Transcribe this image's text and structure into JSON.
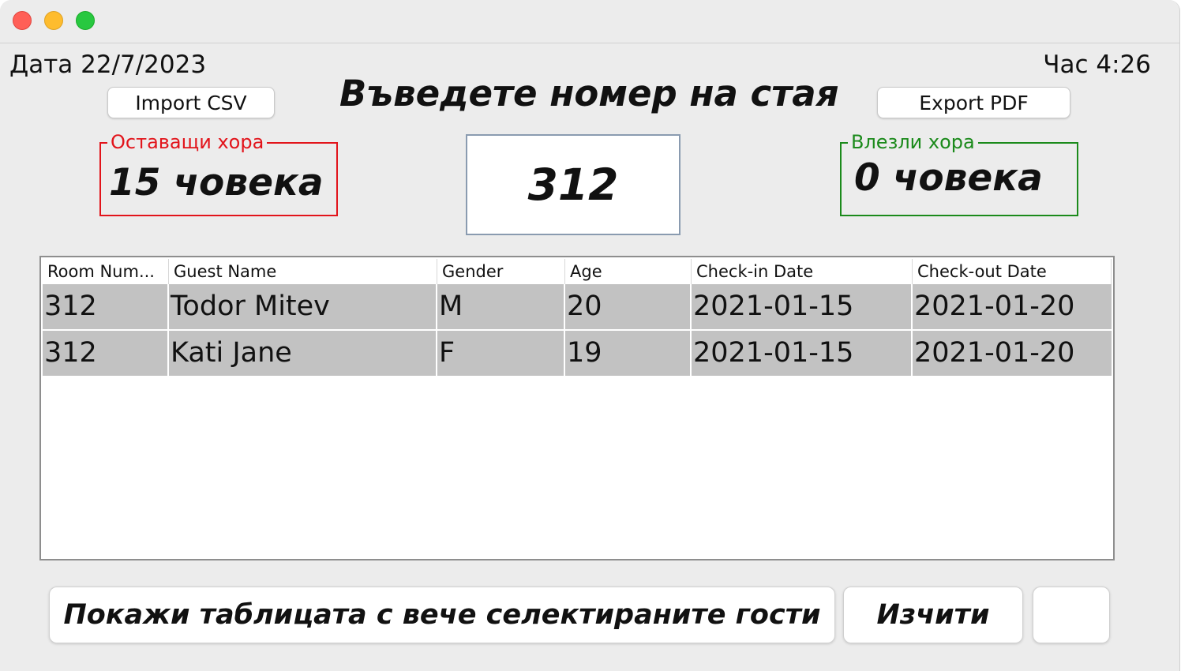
{
  "header": {
    "date": "Дата 22/7/2023",
    "time": "Час 4:26",
    "title": "Въведете номер на стая"
  },
  "toolbar": {
    "import_label": "Import CSV",
    "export_label": "Export PDF"
  },
  "counters": {
    "remaining_label": "Оставащи хора",
    "remaining_value": "15 човека",
    "entered_label": "Влезли хора",
    "entered_value": "0 човека"
  },
  "room_input": {
    "value": "312"
  },
  "table": {
    "columns": [
      "Room Num...",
      "Guest Name",
      "Gender",
      "Age",
      "Check-in Date",
      "Check-out Date"
    ],
    "rows": [
      [
        "312",
        "Todor Mitev",
        "M",
        "20",
        "2021-01-15",
        "2021-01-20"
      ],
      [
        "312",
        "Kati Jane",
        "F",
        "19",
        "2021-01-15",
        "2021-01-20"
      ]
    ]
  },
  "actions": {
    "show_selected_label": "Покажи таблицата с вече селектираните гости",
    "clear_label": "Изчити",
    "blank_label": ""
  },
  "colors": {
    "remaining_border": "#e2141b",
    "entered_border": "#1b8a1b",
    "selected_row": "#c2c2c2"
  }
}
